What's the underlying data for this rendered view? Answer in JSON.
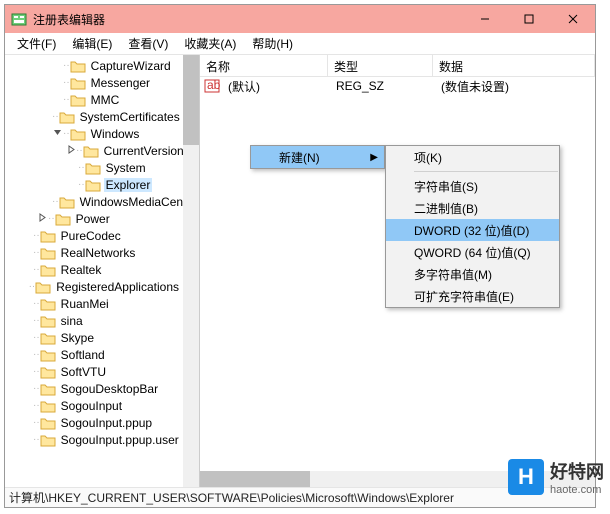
{
  "window": {
    "title": "注册表编辑器"
  },
  "menu": {
    "file": "文件(F)",
    "edit": "编辑(E)",
    "view": "查看(V)",
    "favorites": "收藏夹(A)",
    "help": "帮助(H)"
  },
  "tree": [
    {
      "indent": 3,
      "expand": "",
      "label": "CaptureWizard"
    },
    {
      "indent": 3,
      "expand": "",
      "label": "Messenger"
    },
    {
      "indent": 3,
      "expand": "",
      "label": "MMC"
    },
    {
      "indent": 3,
      "expand": "",
      "label": "SystemCertificates"
    },
    {
      "indent": 3,
      "expand": "v",
      "label": "Windows"
    },
    {
      "indent": 4,
      "expand": ">",
      "label": "CurrentVersion"
    },
    {
      "indent": 4,
      "expand": "",
      "label": "System"
    },
    {
      "indent": 4,
      "expand": "",
      "label": "Explorer",
      "selected": true
    },
    {
      "indent": 3,
      "expand": "",
      "label": "WindowsMediaCenter"
    },
    {
      "indent": 2,
      "expand": ">",
      "label": "Power"
    },
    {
      "indent": 1,
      "expand": "",
      "label": "PureCodec"
    },
    {
      "indent": 1,
      "expand": "",
      "label": "RealNetworks"
    },
    {
      "indent": 1,
      "expand": "",
      "label": "Realtek"
    },
    {
      "indent": 1,
      "expand": "",
      "label": "RegisteredApplications"
    },
    {
      "indent": 1,
      "expand": "",
      "label": "RuanMei"
    },
    {
      "indent": 1,
      "expand": "",
      "label": "sina"
    },
    {
      "indent": 1,
      "expand": "",
      "label": "Skype"
    },
    {
      "indent": 1,
      "expand": "",
      "label": "Softland"
    },
    {
      "indent": 1,
      "expand": "",
      "label": "SoftVTU"
    },
    {
      "indent": 1,
      "expand": "",
      "label": "SogouDesktopBar"
    },
    {
      "indent": 1,
      "expand": "",
      "label": "SogouInput"
    },
    {
      "indent": 1,
      "expand": "",
      "label": "SogouInput.ppup"
    },
    {
      "indent": 1,
      "expand": "",
      "label": "SogouInput.ppup.user"
    }
  ],
  "columns": {
    "name": "名称",
    "type": "类型",
    "data": "数据"
  },
  "rows": [
    {
      "name": "(默认)",
      "type": "REG_SZ",
      "data": "(数值未设置)"
    }
  ],
  "cm": {
    "new": "新建(N)",
    "sub": {
      "key": "项(K)",
      "string": "字符串值(S)",
      "binary": "二进制值(B)",
      "dword": "DWORD (32 位)值(D)",
      "qword": "QWORD (64 位)值(Q)",
      "multisz": "多字符串值(M)",
      "expandsz": "可扩充字符串值(E)"
    }
  },
  "status": "计算机\\HKEY_CURRENT_USER\\SOFTWARE\\Policies\\Microsoft\\Windows\\Explorer",
  "watermark": {
    "logo": "H",
    "big": "好特网",
    "small": "haote.com"
  }
}
